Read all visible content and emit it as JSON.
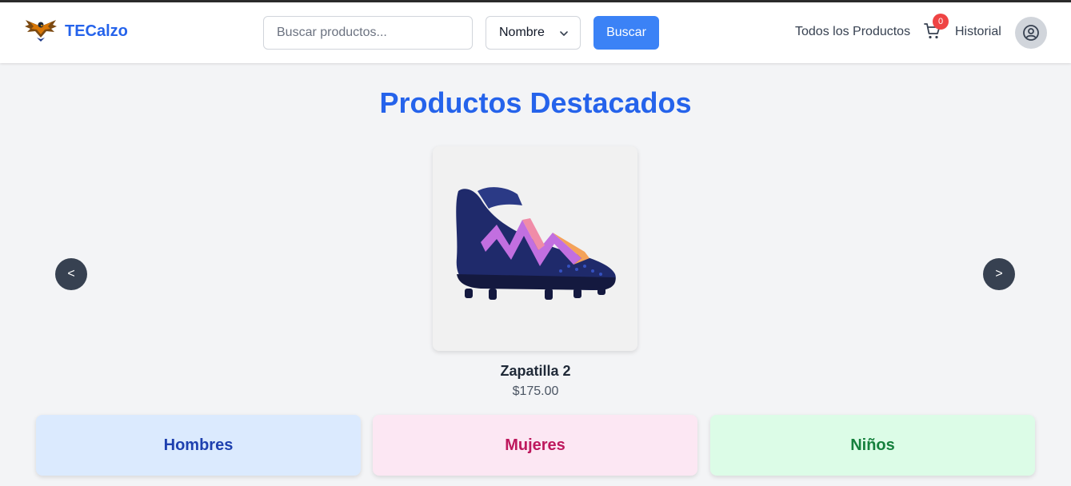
{
  "header": {
    "brand": "TECalzo",
    "search": {
      "placeholder": "Buscar productos...",
      "value": ""
    },
    "sort_select": {
      "selected": "Nombre"
    },
    "search_button": "Buscar",
    "nav": {
      "all_products": "Todos los Productos",
      "history": "Historial"
    },
    "cart": {
      "count": "0",
      "icon": "cart-icon"
    },
    "avatar_icon": "user-circle-icon"
  },
  "featured": {
    "title": "Productos Destacados",
    "prev_label": "<",
    "next_label": ">",
    "product": {
      "name": "Zapatilla 2",
      "price": "$175.00"
    }
  },
  "categories": [
    {
      "label": "Hombres",
      "bg": "#dbeafe",
      "color": "#1e40af"
    },
    {
      "label": "Mujeres",
      "bg": "#fce7f3",
      "color": "#be185d"
    },
    {
      "label": "Niños",
      "bg": "#dcfce7",
      "color": "#15803d"
    }
  ],
  "colors": {
    "accent": "#2563eb",
    "button": "#3b82f6",
    "badge": "#ef4444"
  }
}
